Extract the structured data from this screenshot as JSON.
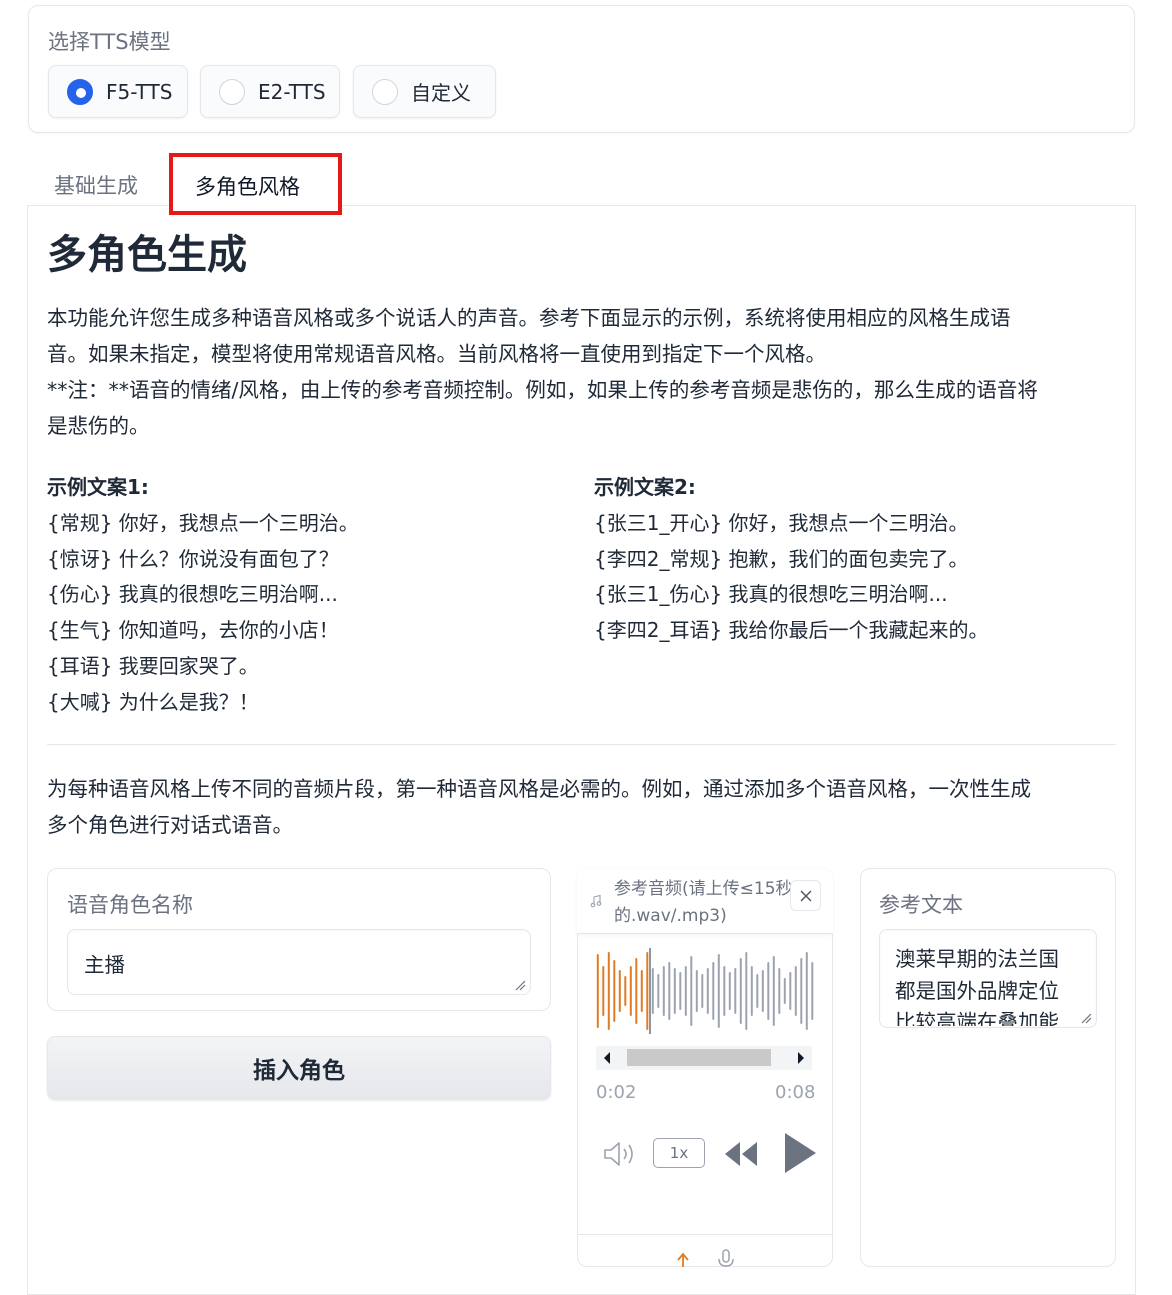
{
  "model_selector": {
    "label": "选择TTS模型",
    "options": [
      {
        "label": "F5-TTS",
        "checked": true
      },
      {
        "label": "E2-TTS",
        "checked": false
      },
      {
        "label": "自定义",
        "checked": false
      }
    ]
  },
  "tabs": [
    {
      "label": "基础生成",
      "active": false
    },
    {
      "label": "多角色风格",
      "active": true,
      "highlight_color": "#e61919"
    }
  ],
  "main": {
    "heading": "多角色生成",
    "intro_lines": [
      "本功能允许您生成多种语音风格或多个说话人的声音。参考下面显示的示例，系统将使用相应的风格生成语",
      "音。如果未指定，模型将使用常规语音风格。当前风格将一直使用到指定下一个风格。",
      "**注：**语音的情绪/风格，由上传的参考音频控制。例如，如果上传的参考音频是悲伤的，那么生成的语音将",
      "是悲伤的。"
    ],
    "example1": {
      "title": "示例文案1:",
      "lines": [
        "{常规} 你好，我想点一个三明治。",
        "{惊讶} 什么？你说没有面包了？",
        "{伤心} 我真的很想吃三明治啊...",
        "{生气} 你知道吗，去你的小店！",
        "{耳语} 我要回家哭了。",
        "{大喊} 为什么是我？！"
      ]
    },
    "example2": {
      "title": "示例文案2:",
      "lines": [
        "{张三1_开心} 你好，我想点一个三明治。",
        "{李四2_常规} 抱歉，我们的面包卖完了。",
        "{张三1_伤心} 我真的很想吃三明治啊...",
        "{李四2_耳语} 我给你最后一个我藏起来的。"
      ]
    },
    "upload_lines": [
      "为每种语音风格上传不同的音频片段，第一种语音风格是必需的。例如，通过添加多个语音风格，一次性生成",
      "多个角色进行对话式语音。"
    ]
  },
  "role_card": {
    "label": "语音角色名称",
    "value": "主播",
    "insert_button": "插入角色"
  },
  "audio": {
    "title_line1": "参考音频(请上传≤15秒",
    "title_line2": "的.wav/.mp3)",
    "current_time": "0:02",
    "duration": "0:08",
    "played_fraction": 0.25,
    "speed": "1x",
    "played_color": "#e07b24",
    "unplayed_color": "#9ca3af",
    "icons": [
      "music-note-icon",
      "close-icon",
      "volume-icon",
      "rewind-icon",
      "play-icon",
      "upload-icon",
      "microphone-icon"
    ]
  },
  "ref_text_card": {
    "label": "参考文本",
    "lines": [
      "澳莱早期的法兰国",
      "都是国外品牌定位",
      "比较高端在叠加能"
    ]
  }
}
